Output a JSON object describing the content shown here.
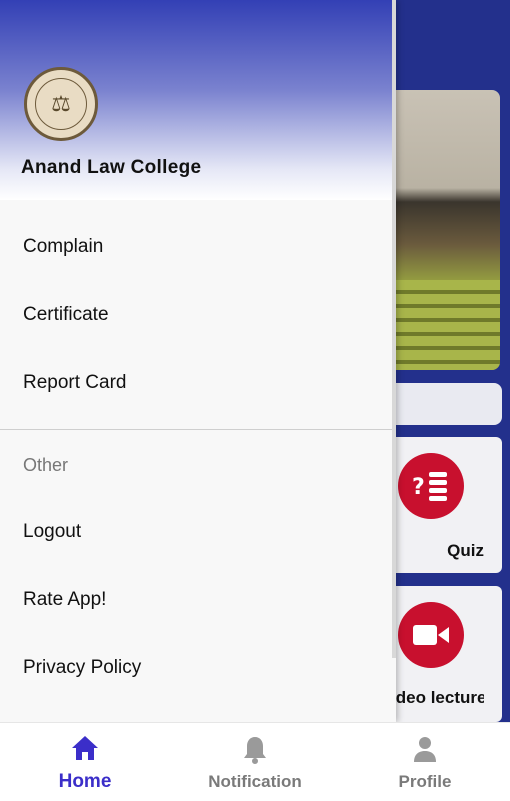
{
  "drawer": {
    "college_name": "Anand Law College",
    "menu": [
      {
        "label": "Complain"
      },
      {
        "label": "Certificate"
      },
      {
        "label": "Report Card"
      }
    ],
    "section_title": "Other",
    "other_menu": [
      {
        "label": "Logout"
      },
      {
        "label": "Rate App!"
      },
      {
        "label": "Privacy Policy"
      }
    ]
  },
  "background": {
    "cards": [
      {
        "label": "Quiz",
        "icon": "quiz-icon"
      },
      {
        "label": "Video lecture",
        "icon": "video-camera-icon"
      }
    ]
  },
  "bottom_nav": {
    "items": [
      {
        "label": "Home",
        "icon": "home-icon",
        "active": true
      },
      {
        "label": "Notification",
        "icon": "bell-icon",
        "active": false
      },
      {
        "label": "Profile",
        "icon": "person-icon",
        "active": false
      }
    ]
  },
  "colors": {
    "accent": "#3b2ec9",
    "header_blue": "#3340b5",
    "card_red": "#c8102e"
  }
}
